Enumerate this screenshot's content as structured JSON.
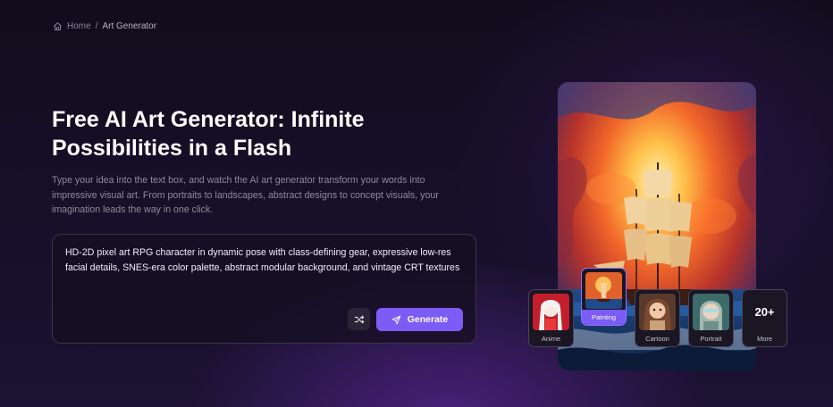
{
  "breadcrumb": {
    "home_label": "Home",
    "separator": "/",
    "current_label": "Art Generator"
  },
  "hero": {
    "title": "Free AI Art Generator: Infinite Possibilities in a Flash",
    "description": "Type your idea into the text box, and watch the AI art generator transform your words into impressive visual art. From portraits to landscapes, abstract designs to concept visuals, your imagination leads the way in one click."
  },
  "prompt": {
    "value": "HD-2D pixel art RPG character in dynamic pose with class-defining gear, expressive low-res facial details, SNES-era color palette, abstract modular background, and vintage CRT textures",
    "shuffle_icon": "shuffle-icon",
    "generate_label": "Generate",
    "generate_icon": "send-icon"
  },
  "styles": {
    "items": [
      {
        "label": "Anime"
      },
      {
        "label": "Painting",
        "active": true
      },
      {
        "label": "Cartoon"
      },
      {
        "label": "Portrait"
      },
      {
        "label": "More",
        "count": "20+"
      }
    ]
  },
  "colors": {
    "accent": "#7b5cf5",
    "background": "#140f22",
    "muted_text": "#8f8a9f"
  }
}
